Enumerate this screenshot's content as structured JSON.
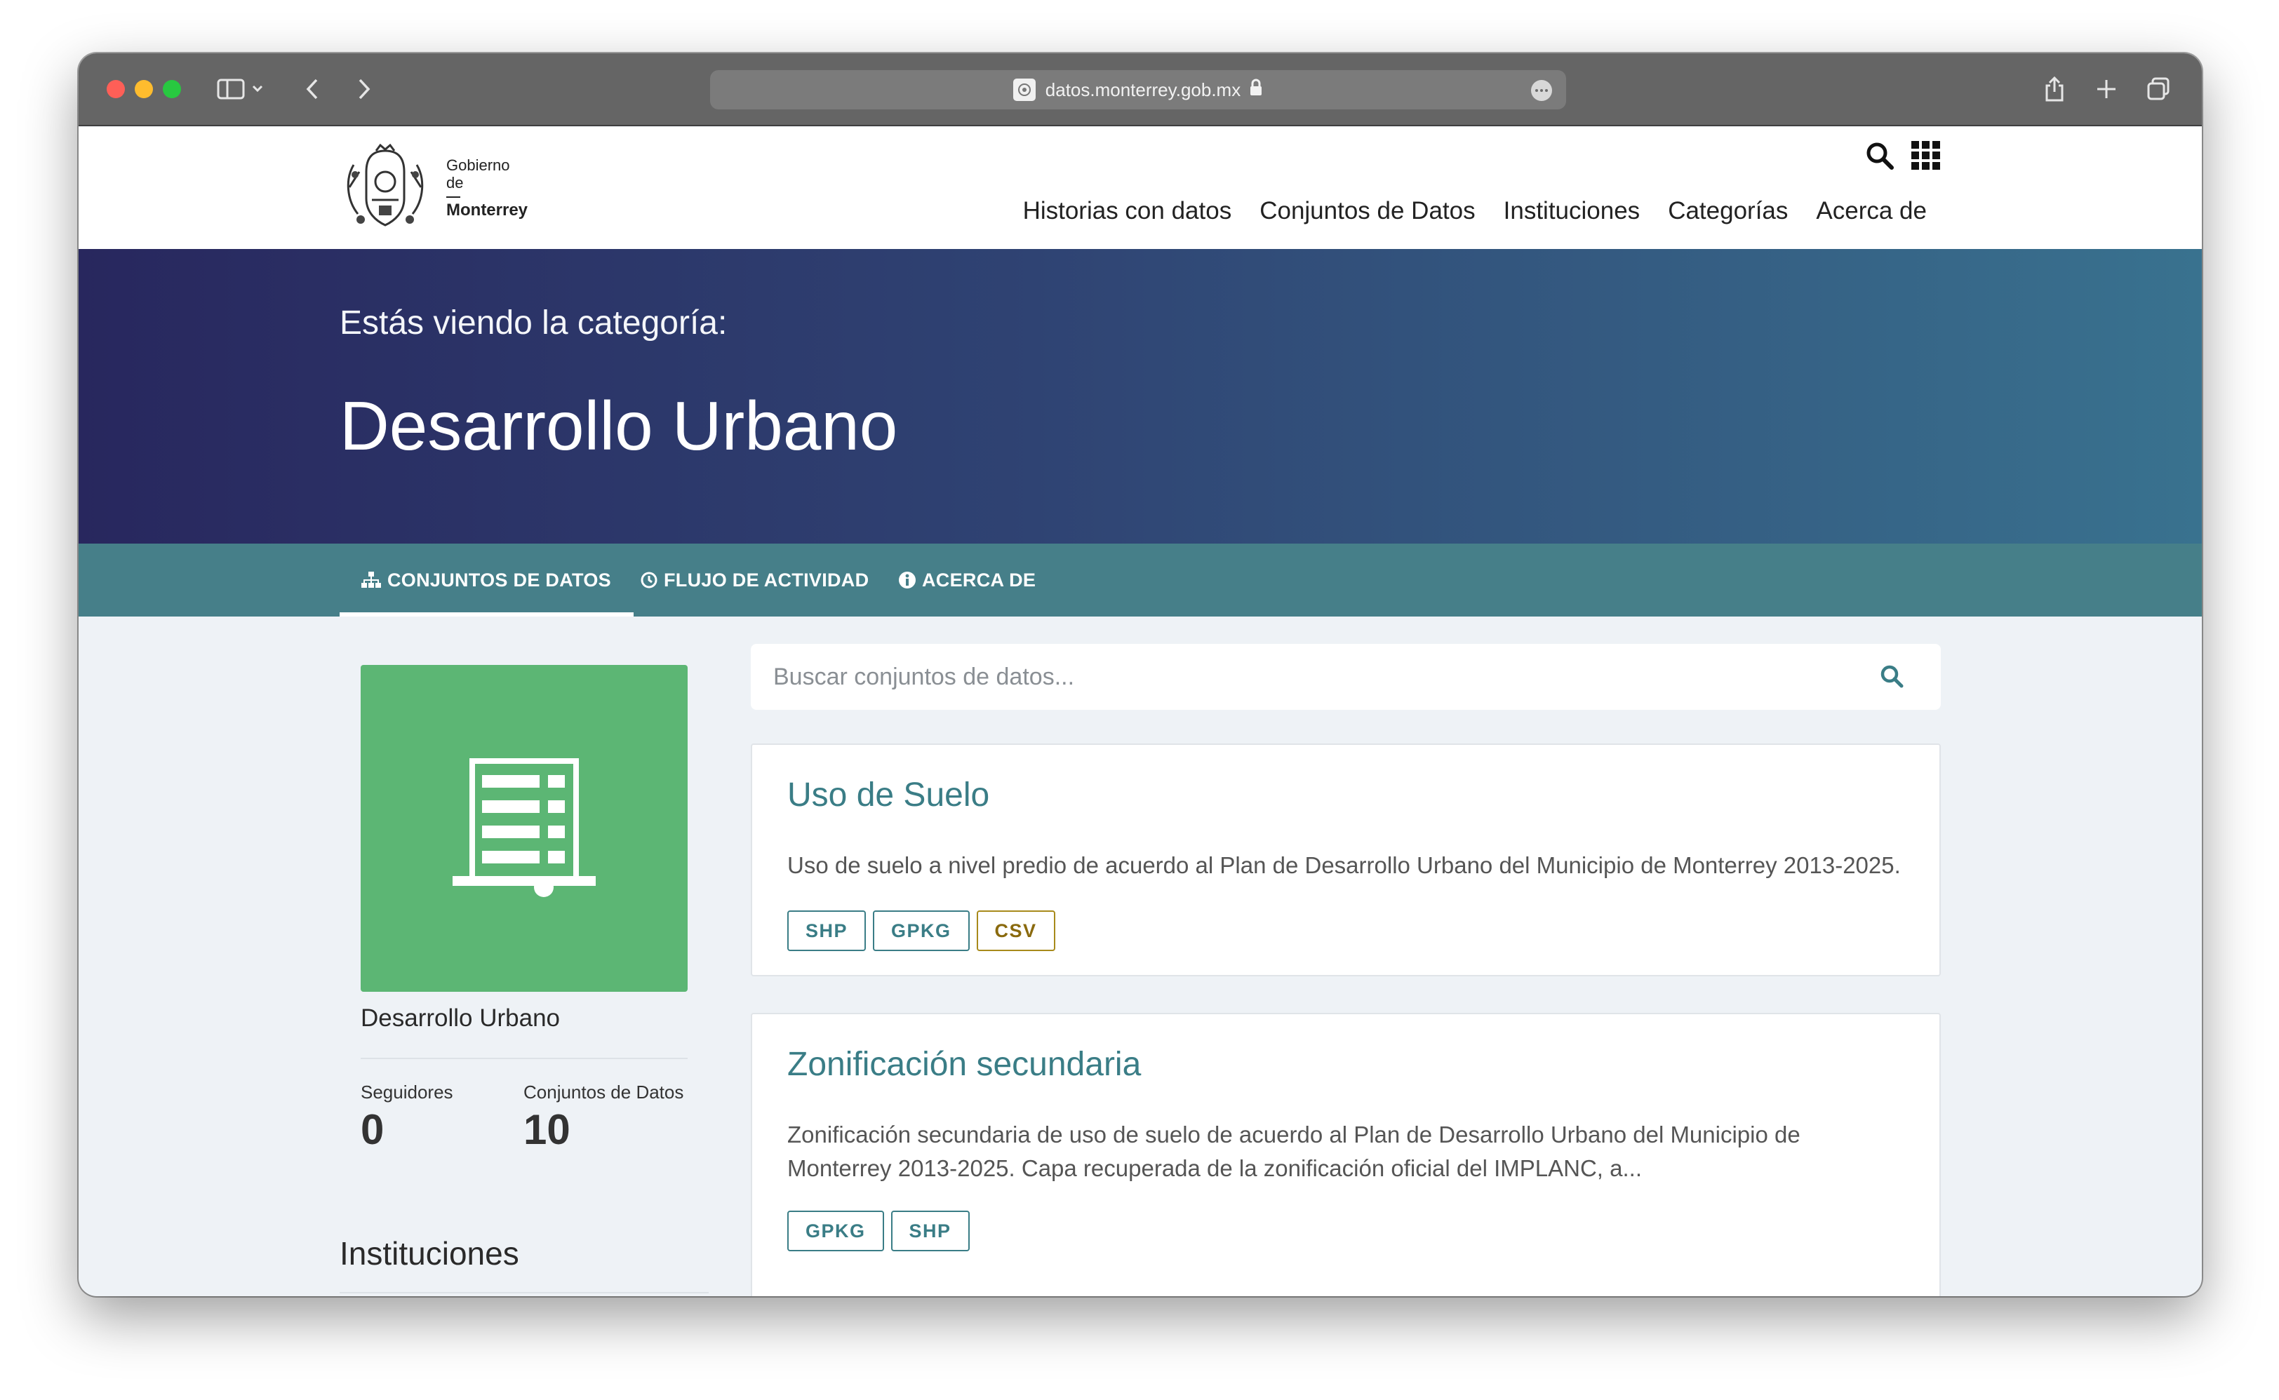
{
  "browser": {
    "url": "datos.monterrey.gob.mx"
  },
  "header": {
    "logo": {
      "line1": "Gobierno",
      "line2": "de",
      "line3": "Monterrey"
    },
    "nav": [
      {
        "label": "Historias con datos"
      },
      {
        "label": "Conjuntos de Datos"
      },
      {
        "label": "Instituciones"
      },
      {
        "label": "Categorías"
      },
      {
        "label": "Acerca de"
      }
    ]
  },
  "hero": {
    "subtitle": "Estás viendo la categoría:",
    "title": "Desarrollo Urbano"
  },
  "tabs": [
    {
      "label": "CONJUNTOS DE DATOS",
      "icon": "sitemap-icon",
      "active": true
    },
    {
      "label": "FLUJO DE ACTIVIDAD",
      "icon": "clock-icon"
    },
    {
      "label": "ACERCA DE",
      "icon": "info-icon"
    }
  ],
  "sidebar": {
    "category_icon": "building-icon",
    "category_color": "#5cb674",
    "category_name": "Desarrollo Urbano",
    "stats": [
      {
        "label": "Seguidores",
        "value": "0"
      },
      {
        "label": "Conjuntos de Datos",
        "value": "10"
      }
    ],
    "institutions_title": "Instituciones"
  },
  "search": {
    "placeholder": "Buscar conjuntos de datos..."
  },
  "datasets": [
    {
      "title": "Uso de Suelo",
      "description": "Uso de suelo a nivel predio de acuerdo al Plan de Desarrollo Urbano del Municipio de Monterrey 2013-2025.",
      "formats": [
        "SHP",
        "GPKG",
        "CSV"
      ]
    },
    {
      "title": "Zonificación secundaria",
      "description": "Zonificación secundaria de uso de suelo de acuerdo al Plan de Desarrollo Urbano del Municipio de Monterrey 2013-2025. Capa recuperada de la zonificación oficial del IMPLANC, a...",
      "formats": [
        "GPKG",
        "SHP"
      ]
    }
  ],
  "colors": {
    "accent": "#3a7d86",
    "tab_bar": "#467f89",
    "hero_start": "#28275e",
    "hero_end": "#39728f",
    "csv_badge": "#a88a1b"
  }
}
